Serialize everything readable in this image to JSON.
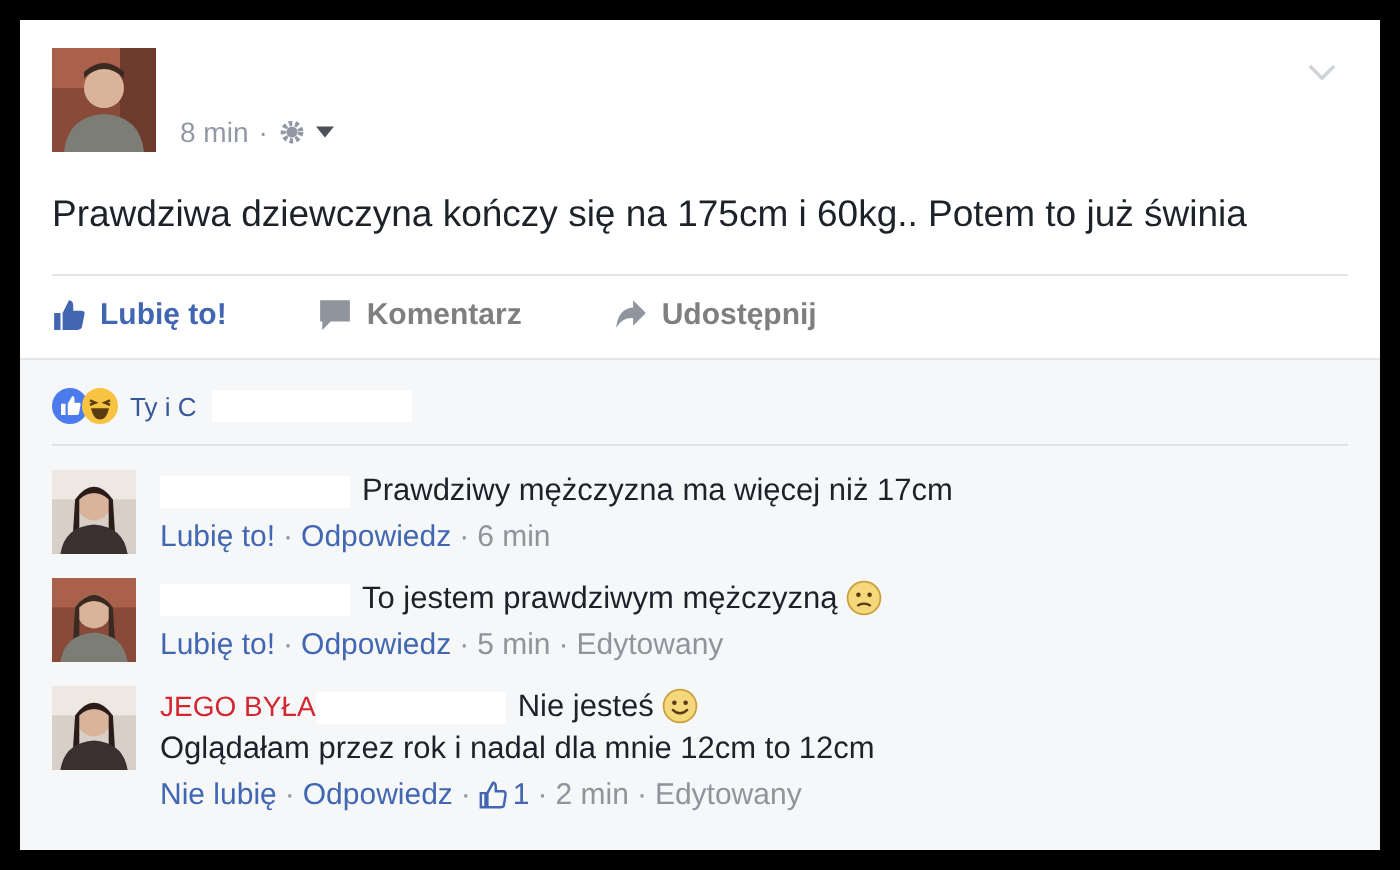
{
  "post": {
    "time": "8 min",
    "separator": "·",
    "text": "Prawdziwa dziewczyna kończy się na 175cm i 60kg.. Potem to już świnia",
    "actions": [
      {
        "kind": "like",
        "label": "Lubię to!",
        "selected": true
      },
      {
        "kind": "comment",
        "label": "Komentarz",
        "selected": false
      },
      {
        "kind": "share",
        "label": "Udostępnij",
        "selected": false
      }
    ]
  },
  "reactions": {
    "text": "Ty i C"
  },
  "separator": "·",
  "comments": [
    {
      "parts": [
        {
          "kind": "text",
          "text": "Prawdziwy mężczyzna ma więcej niż 17cm"
        }
      ],
      "meta": [
        {
          "kind": "link",
          "text": "Lubię to!"
        },
        {
          "kind": "link",
          "text": "Odpowiedz"
        },
        {
          "kind": "text",
          "text": "6 min"
        }
      ]
    },
    {
      "parts": [
        {
          "kind": "text",
          "text": "To jestem prawdziwym mężczyzną"
        },
        {
          "kind": "frown"
        }
      ],
      "meta": [
        {
          "kind": "link",
          "text": "Lubię to!"
        },
        {
          "kind": "link",
          "text": "Odpowiedz"
        },
        {
          "kind": "text",
          "text": "5 min"
        },
        {
          "kind": "text",
          "text": "Edytowany"
        }
      ]
    },
    {
      "name": "JEGO BYŁA",
      "parts": [
        {
          "kind": "text",
          "text": "Nie jesteś"
        },
        {
          "kind": "smile"
        },
        {
          "kind": "text",
          "text": "Oglądałam przez rok i nadal dla mnie 12cm to"
        },
        {
          "kind": "text",
          "text": "12cm"
        }
      ],
      "meta": [
        {
          "kind": "link",
          "text": "Nie lubię"
        },
        {
          "kind": "link",
          "text": "Odpowiedz"
        },
        {
          "kind": "likes",
          "text": "1"
        },
        {
          "kind": "text",
          "text": "2 min"
        },
        {
          "kind": "text",
          "text": "Edytowany"
        }
      ]
    }
  ]
}
